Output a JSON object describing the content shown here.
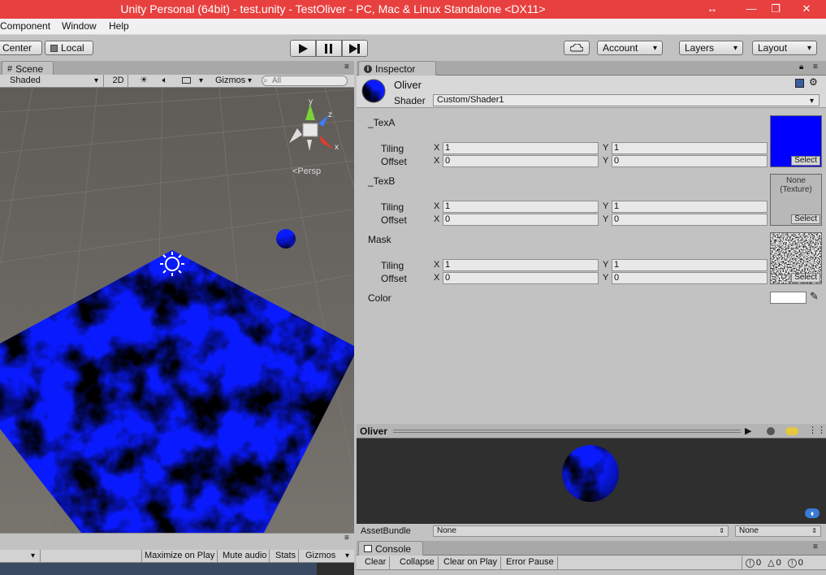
{
  "window": {
    "title": "Unity Personal (64bit) - test.unity - TestOliver - PC, Mac & Linux Standalone <DX11>",
    "title_color": "#e8403f",
    "controls": [
      "↔",
      "—",
      "❐",
      "✕"
    ]
  },
  "menubar": {
    "items": [
      "Component",
      "Window",
      "Help"
    ]
  },
  "toolbar": {
    "pivot_center": "Center",
    "pivot_local": "Local",
    "play_icon": "play-icon",
    "pause_icon": "pause-icon",
    "step_icon": "step-icon",
    "cloud_icon": "cloud-icon",
    "account": "Account",
    "layers": "Layers",
    "layout": "Layout"
  },
  "scene": {
    "tab_label": "Scene",
    "shading_mode": "Shaded",
    "mode_2d": "2D",
    "gizmos": "Gizmos",
    "search_placeholder": "All",
    "projection_label": "<Persp",
    "axis_labels": {
      "y": "y",
      "z": "z",
      "x": "x"
    },
    "accent": "#0a1aff"
  },
  "game": {
    "maximize_on_play": "Maximize on Play",
    "mute_audio": "Mute audio",
    "stats": "Stats",
    "gizmos": "Gizmos"
  },
  "inspector": {
    "tab_label": "Inspector",
    "material_name": "Oliver",
    "shader_label": "Shader",
    "shader_value": "Custom/Shader1",
    "properties": [
      {
        "name": "_TexA",
        "tiling_label": "Tiling",
        "offset_label": "Offset",
        "tiling_x": "1",
        "tiling_y": "1",
        "offset_x": "0",
        "offset_y": "0",
        "texture": "blue",
        "texture_color": "#0000ff",
        "select": "Select"
      },
      {
        "name": "_TexB",
        "tiling_label": "Tiling",
        "offset_label": "Offset",
        "tiling_x": "1",
        "tiling_y": "1",
        "offset_x": "0",
        "offset_y": "0",
        "texture": "none",
        "none_text": "None\n(Texture)",
        "select": "Select"
      },
      {
        "name": "Mask",
        "tiling_label": "Tiling",
        "offset_label": "Offset",
        "tiling_x": "1",
        "tiling_y": "1",
        "offset_x": "0",
        "offset_y": "0",
        "texture": "noise",
        "select": "Select"
      }
    ],
    "axis_x": "X",
    "axis_y": "Y",
    "color_label": "Color",
    "color_value": "#ffffff"
  },
  "preview": {
    "title": "Oliver",
    "assetbundle_label": "AssetBundle",
    "assetbundle_value": "None",
    "variant_value": "None"
  },
  "console": {
    "tab_label": "Console",
    "clear": "Clear",
    "collapse": "Collapse",
    "clear_on_play": "Clear on Play",
    "error_pause": "Error Pause",
    "log_count": "0",
    "warning_count": "0",
    "error_count": "0"
  }
}
